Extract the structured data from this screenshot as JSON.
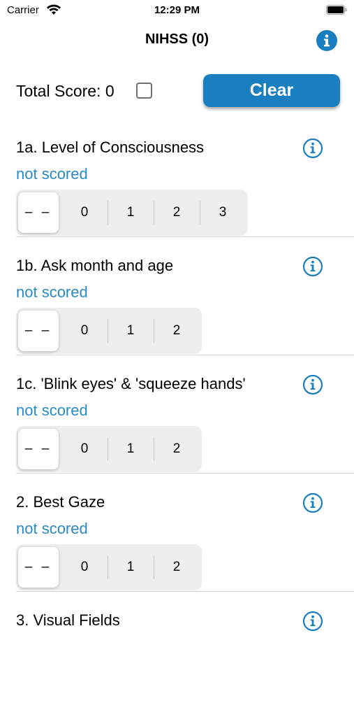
{
  "status_bar": {
    "carrier": "Carrier",
    "time": "12:29 PM"
  },
  "nav": {
    "title": "NIHSS (0)",
    "info_icon": "info-icon"
  },
  "total": {
    "label": "Total Score: 0",
    "clear_label": "Clear"
  },
  "accent_color": "#1a7fc1",
  "items": [
    {
      "title": "1a. Level of Consciousness",
      "status": "not scored",
      "options": [
        "– –",
        "0",
        "1",
        "2",
        "3"
      ],
      "selected": "– –"
    },
    {
      "title": "1b. Ask month and age",
      "status": "not scored",
      "options": [
        "– –",
        "0",
        "1",
        "2"
      ],
      "selected": "– –"
    },
    {
      "title": "1c. 'Blink eyes' & 'squeeze hands'",
      "status": "not scored",
      "options": [
        "– –",
        "0",
        "1",
        "2"
      ],
      "selected": "– –"
    },
    {
      "title": "2. Best Gaze",
      "status": "not scored",
      "options": [
        "– –",
        "0",
        "1",
        "2"
      ],
      "selected": "– –"
    },
    {
      "title": "3. Visual Fields",
      "status": "",
      "options": [],
      "selected": ""
    }
  ]
}
